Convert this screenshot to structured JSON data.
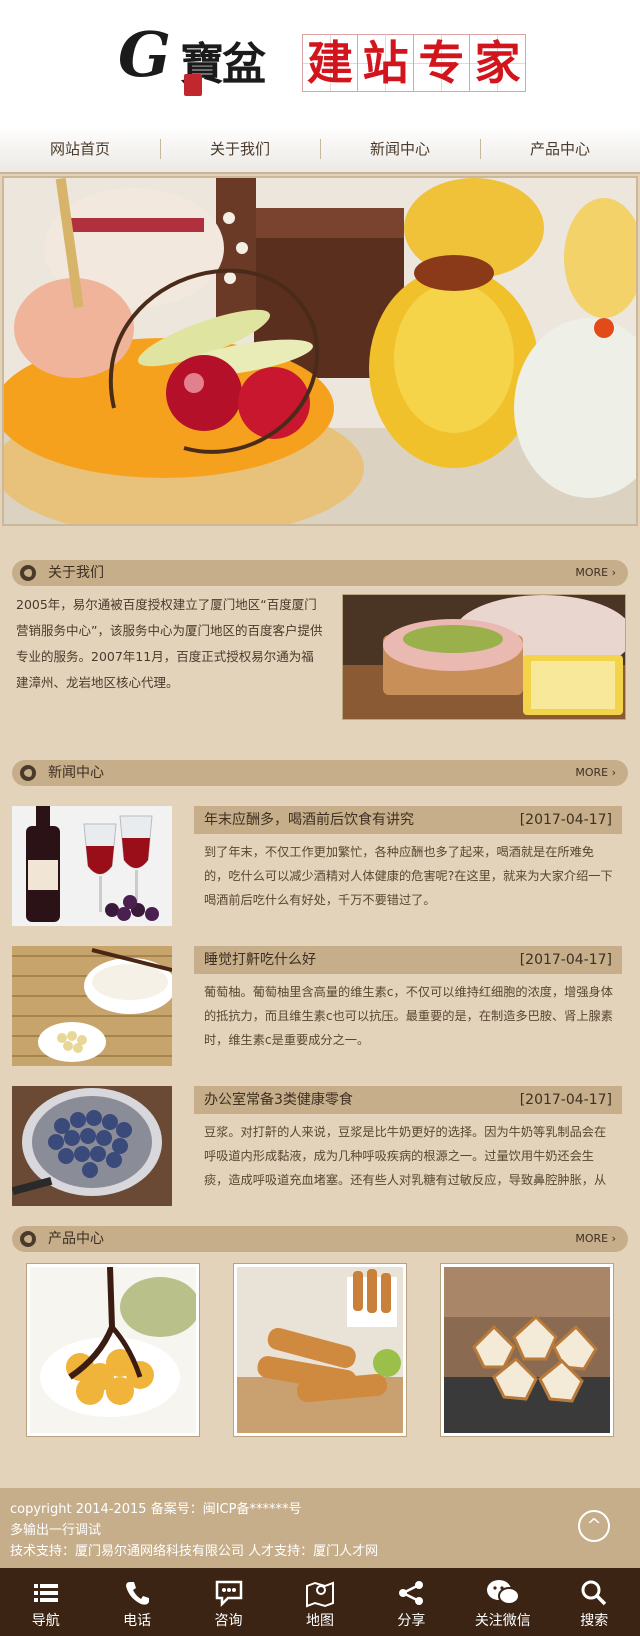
{
  "logo": {
    "brand_glyph": "G",
    "brand_cn": "寶盆",
    "title_chars": [
      "建",
      "站",
      "专",
      "家"
    ]
  },
  "nav": {
    "items": [
      "网站首页",
      "关于我们",
      "新闻中心",
      "产品中心"
    ]
  },
  "about": {
    "title": "关于我们",
    "more": "MORE",
    "text": "2005年，易尔通被百度授权建立了厦门地区“百度厦门营销服务中心”，该服务中心为厦门地区的百度客户提供专业的服务。2007年11月，百度正式授权易尔通为福建漳州、龙岩地区核心代理。"
  },
  "news": {
    "title": "新闻中心",
    "more": "MORE",
    "items": [
      {
        "title": "年末应酬多，喝酒前后饮食有讲究",
        "date": "[2017-04-17]",
        "desc": "到了年末，不仅工作更加繁忙，各种应酬也多了起来，喝酒就是在所难免的，吃什么可以减少酒精对人体健康的危害呢?在这里，就来为大家介绍一下喝酒前后吃什么有好处，千万不要错过了。"
      },
      {
        "title": "睡觉打鼾吃什么好",
        "date": "[2017-04-17]",
        "desc": "葡萄柚。葡萄柚里含高量的维生素c，不仅可以维持红细胞的浓度，增强身体的抵抗力，而且维生素c也可以抗压。最重要的是，在制造多巴胺、肾上腺素时，维生素c是重要成分之一。"
      },
      {
        "title": "办公室常备3类健康零食",
        "date": "[2017-04-17]",
        "desc": "豆浆。对打鼾的人来说，豆浆是比牛奶更好的选择。因为牛奶等乳制品会在呼吸道内形成黏液，成为几种呼吸疾病的根源之一。过量饮用牛奶还会生痰，造成呼吸道充血堵塞。还有些人对乳糖有过敏反应，导致鼻腔肿胀，从而引发打"
      }
    ]
  },
  "products": {
    "title": "产品中心",
    "more": "MORE"
  },
  "footer": {
    "line1": "copyright 2014-2015 备案号：闽ICP备******号",
    "line2": "多输出一行调试",
    "line3": "技术支持：厦门易尔通网络科技有限公司 人才支持：厦门人才网",
    "to_top": "^"
  },
  "tabbar": {
    "items": [
      {
        "label": "导航",
        "icon": "menu-icon"
      },
      {
        "label": "电话",
        "icon": "phone-icon"
      },
      {
        "label": "咨询",
        "icon": "chat-icon"
      },
      {
        "label": "地图",
        "icon": "map-icon"
      },
      {
        "label": "分享",
        "icon": "share-icon"
      },
      {
        "label": "关注微信",
        "icon": "wechat-icon"
      },
      {
        "label": "搜索",
        "icon": "search-icon"
      }
    ]
  },
  "colors": {
    "accent": "#c6ae8b",
    "background": "#e3d3bb",
    "tabbar": "#3b2414",
    "logo_red": "#d2141c"
  }
}
